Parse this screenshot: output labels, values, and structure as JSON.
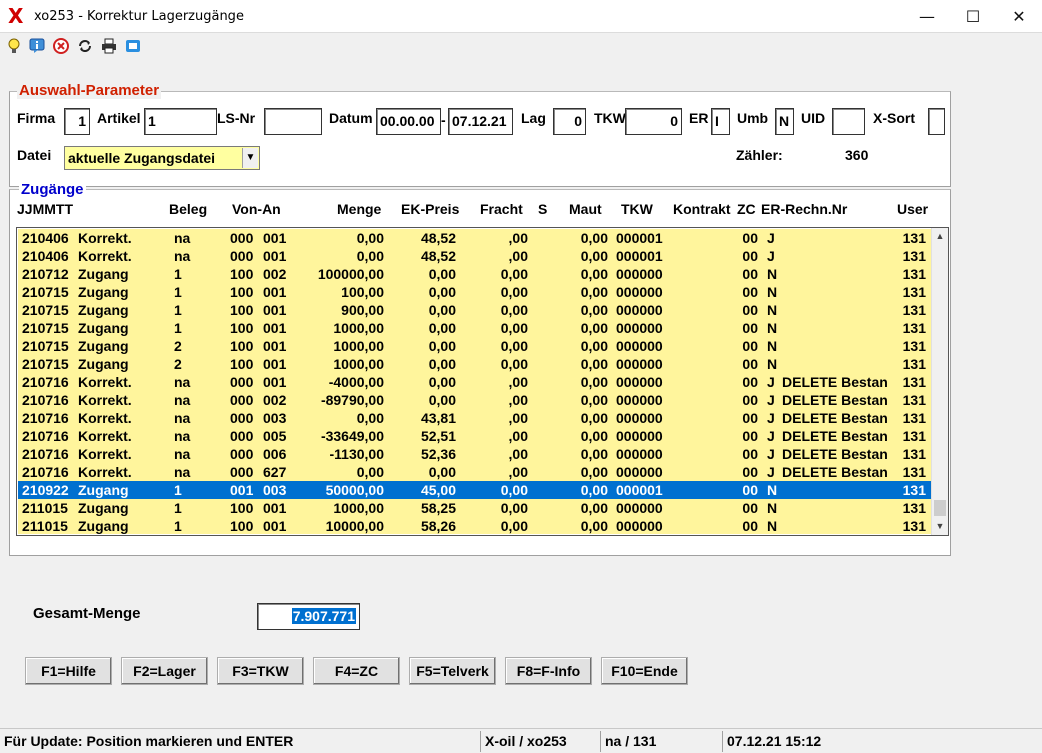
{
  "window": {
    "title": "xo253 - Korrektur Lagerzugänge",
    "app_icon": "X",
    "minimize": "—",
    "maximize": "☐",
    "close": "✕"
  },
  "toolbar": {
    "icons": [
      "lightbulb-icon",
      "info-icon",
      "cancel-icon",
      "refresh-icon",
      "printer-icon",
      "window-icon"
    ]
  },
  "params": {
    "legend": "Auswahl-Parameter",
    "firma_label": "Firma",
    "firma": "1",
    "artikel_label": "Artikel",
    "artikel": "1",
    "lsnr_label": "LS-Nr",
    "lsnr": "",
    "datum_label": "Datum",
    "datum_from": "00.00.00",
    "datum_sep": "-",
    "datum_to": "07.12.21",
    "lag_label": "Lag",
    "lag": "0",
    "tkw_label": "TKW",
    "tkw": "0",
    "er_label": "ER",
    "er": "I",
    "umb_label": "Umb",
    "umb": "N",
    "uid_label": "UID",
    "uid": "",
    "xsort_label": "X-Sort",
    "xsort": "",
    "datei_label": "Datei",
    "datei": "aktuelle Zugangsdatei",
    "zaehler_label": "Zähler:",
    "zaehler": "360"
  },
  "grid": {
    "legend": "Zugänge",
    "headers": {
      "date": "JJMMTT",
      "beleg": "Beleg",
      "vonan": "Von-An",
      "menge": "Menge",
      "ekpreis": "EK-Preis",
      "fracht": "Fracht",
      "s": "S",
      "maut": "Maut",
      "tkw": "TKW",
      "kontrakt": "Kontrakt",
      "zc": "ZC",
      "er": "ER-Rechn.Nr",
      "user": "User"
    },
    "rows": [
      {
        "date": "210406",
        "type": "Korrekt.",
        "beleg": "na",
        "von": "000",
        "an": "001",
        "menge": "0,00",
        "ekpreis": "48,52",
        "fracht": ",00",
        "maut": "0,00",
        "tkw": "000001",
        "zc": "00",
        "er": "J",
        "er_text": "",
        "user": "131"
      },
      {
        "date": "210406",
        "type": "Korrekt.",
        "beleg": "na",
        "von": "000",
        "an": "001",
        "menge": "0,00",
        "ekpreis": "48,52",
        "fracht": ",00",
        "maut": "0,00",
        "tkw": "000001",
        "zc": "00",
        "er": "J",
        "er_text": "",
        "user": "131"
      },
      {
        "date": "210712",
        "type": "Zugang",
        "beleg": "1",
        "von": "100",
        "an": "002",
        "menge": "100000,00",
        "ekpreis": "0,00",
        "fracht": "0,00",
        "maut": "0,00",
        "tkw": "000000",
        "zc": "00",
        "er": "N",
        "er_text": "",
        "user": "131"
      },
      {
        "date": "210715",
        "type": "Zugang",
        "beleg": "1",
        "von": "100",
        "an": "001",
        "menge": "100,00",
        "ekpreis": "0,00",
        "fracht": "0,00",
        "maut": "0,00",
        "tkw": "000000",
        "zc": "00",
        "er": "N",
        "er_text": "",
        "user": "131"
      },
      {
        "date": "210715",
        "type": "Zugang",
        "beleg": "1",
        "von": "100",
        "an": "001",
        "menge": "900,00",
        "ekpreis": "0,00",
        "fracht": "0,00",
        "maut": "0,00",
        "tkw": "000000",
        "zc": "00",
        "er": "N",
        "er_text": "",
        "user": "131"
      },
      {
        "date": "210715",
        "type": "Zugang",
        "beleg": "1",
        "von": "100",
        "an": "001",
        "menge": "1000,00",
        "ekpreis": "0,00",
        "fracht": "0,00",
        "maut": "0,00",
        "tkw": "000000",
        "zc": "00",
        "er": "N",
        "er_text": "",
        "user": "131"
      },
      {
        "date": "210715",
        "type": "Zugang",
        "beleg": "2",
        "von": "100",
        "an": "001",
        "menge": "1000,00",
        "ekpreis": "0,00",
        "fracht": "0,00",
        "maut": "0,00",
        "tkw": "000000",
        "zc": "00",
        "er": "N",
        "er_text": "",
        "user": "131"
      },
      {
        "date": "210715",
        "type": "Zugang",
        "beleg": "2",
        "von": "100",
        "an": "001",
        "menge": "1000,00",
        "ekpreis": "0,00",
        "fracht": "0,00",
        "maut": "0,00",
        "tkw": "000000",
        "zc": "00",
        "er": "N",
        "er_text": "",
        "user": "131"
      },
      {
        "date": "210716",
        "type": "Korrekt.",
        "beleg": "na",
        "von": "000",
        "an": "001",
        "menge": "-4000,00",
        "ekpreis": "0,00",
        "fracht": ",00",
        "maut": "0,00",
        "tkw": "000000",
        "zc": "00",
        "er": "J",
        "er_text": "DELETE Bestan",
        "user": "131"
      },
      {
        "date": "210716",
        "type": "Korrekt.",
        "beleg": "na",
        "von": "000",
        "an": "002",
        "menge": "-89790,00",
        "ekpreis": "0,00",
        "fracht": ",00",
        "maut": "0,00",
        "tkw": "000000",
        "zc": "00",
        "er": "J",
        "er_text": "DELETE Bestan",
        "user": "131"
      },
      {
        "date": "210716",
        "type": "Korrekt.",
        "beleg": "na",
        "von": "000",
        "an": "003",
        "menge": "0,00",
        "ekpreis": "43,81",
        "fracht": ",00",
        "maut": "0,00",
        "tkw": "000000",
        "zc": "00",
        "er": "J",
        "er_text": "DELETE Bestan",
        "user": "131"
      },
      {
        "date": "210716",
        "type": "Korrekt.",
        "beleg": "na",
        "von": "000",
        "an": "005",
        "menge": "-33649,00",
        "ekpreis": "52,51",
        "fracht": ",00",
        "maut": "0,00",
        "tkw": "000000",
        "zc": "00",
        "er": "J",
        "er_text": "DELETE Bestan",
        "user": "131"
      },
      {
        "date": "210716",
        "type": "Korrekt.",
        "beleg": "na",
        "von": "000",
        "an": "006",
        "menge": "-1130,00",
        "ekpreis": "52,36",
        "fracht": ",00",
        "maut": "0,00",
        "tkw": "000000",
        "zc": "00",
        "er": "J",
        "er_text": "DELETE Bestan",
        "user": "131"
      },
      {
        "date": "210716",
        "type": "Korrekt.",
        "beleg": "na",
        "von": "000",
        "an": "627",
        "menge": "0,00",
        "ekpreis": "0,00",
        "fracht": ",00",
        "maut": "0,00",
        "tkw": "000000",
        "zc": "00",
        "er": "J",
        "er_text": "DELETE Bestan",
        "user": "131"
      },
      {
        "date": "210922",
        "type": "Zugang",
        "beleg": "1",
        "von": "001",
        "an": "003",
        "menge": "50000,00",
        "ekpreis": "45,00",
        "fracht": "0,00",
        "maut": "0,00",
        "tkw": "000001",
        "zc": "00",
        "er": "N",
        "er_text": "",
        "user": "131",
        "selected": true
      },
      {
        "date": "211015",
        "type": "Zugang",
        "beleg": "1",
        "von": "100",
        "an": "001",
        "menge": "1000,00",
        "ekpreis": "58,25",
        "fracht": "0,00",
        "maut": "0,00",
        "tkw": "000000",
        "zc": "00",
        "er": "N",
        "er_text": "",
        "user": "131"
      },
      {
        "date": "211015",
        "type": "Zugang",
        "beleg": "1",
        "von": "100",
        "an": "001",
        "menge": "10000,00",
        "ekpreis": "58,26",
        "fracht": "0,00",
        "maut": "0,00",
        "tkw": "000000",
        "zc": "00",
        "er": "N",
        "er_text": "",
        "user": "131"
      }
    ]
  },
  "summary": {
    "gesamt_label": "Gesamt-Menge",
    "gesamt_value": "7.907.771"
  },
  "buttons": [
    {
      "label": "F1=Hilfe"
    },
    {
      "label": "F2=Lager"
    },
    {
      "label": "F3=TKW"
    },
    {
      "label": "F4=ZC"
    },
    {
      "label": "F5=Telverk"
    },
    {
      "label": "F8=F-Info"
    },
    {
      "label": "F10=Ende"
    }
  ],
  "status": {
    "message": "Für Update: Position markieren und ENTER",
    "program": "X-oil / xo253",
    "user": "na / 131",
    "datetime": "07.12.21 15:12"
  },
  "colors": {
    "grid_row_bg": "#fff59c",
    "selected_row_bg": "#0070d0",
    "legend_params": "#d02000",
    "legend_grid": "#0000cc",
    "combo_bg": "#ffffa0"
  }
}
